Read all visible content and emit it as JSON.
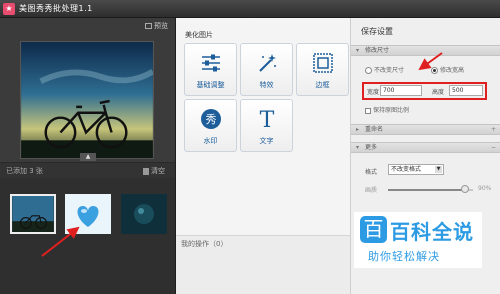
{
  "window": {
    "title": "美图秀秀批处理1.1",
    "app_icon": "meitu-app-icon"
  },
  "left_panel": {
    "preview_label": "预览",
    "added_count": "已添加 3 张",
    "clear_label": "清空",
    "collapse_glyph": "▲",
    "thumbnails": [
      {
        "name": "bicycle-photo",
        "selected": true
      },
      {
        "name": "blue-heart-photo",
        "selected": false
      },
      {
        "name": "underwater-photo",
        "selected": false
      }
    ]
  },
  "middle_panel": {
    "title": "美化图片",
    "tools": [
      {
        "label": "基础调整",
        "icon": "sliders-icon"
      },
      {
        "label": "特效",
        "icon": "magic-wand-icon"
      },
      {
        "label": "边框",
        "icon": "frame-icon"
      },
      {
        "label": "水印",
        "icon": "watermark-icon",
        "glyph": "秀"
      },
      {
        "label": "文字",
        "icon": "text-icon",
        "glyph": "T"
      }
    ],
    "ops_label": "我的操作（0）"
  },
  "right_panel": {
    "title": "保存设置",
    "size_section": "修改尺寸",
    "radio_keep": "不改变尺寸",
    "radio_change": "修改宽高",
    "width_label": "宽度",
    "width_value": "700",
    "height_label": "高度",
    "height_value": "500",
    "keep_ratio": "保持原图比例",
    "rename_section": "重命名",
    "more_section": "更多",
    "format_label": "格式",
    "format_value": "不改变格式",
    "quality_label": "画质",
    "quality_value": "90%",
    "quality_fraction": 0.9
  },
  "watermark": {
    "badge": "百",
    "big": "百科全说",
    "small": "助你轻松解决"
  },
  "colors": {
    "annotation_red": "#e02020",
    "accent_blue": "#1c5d9a",
    "brand_blue": "#2d9be3"
  }
}
